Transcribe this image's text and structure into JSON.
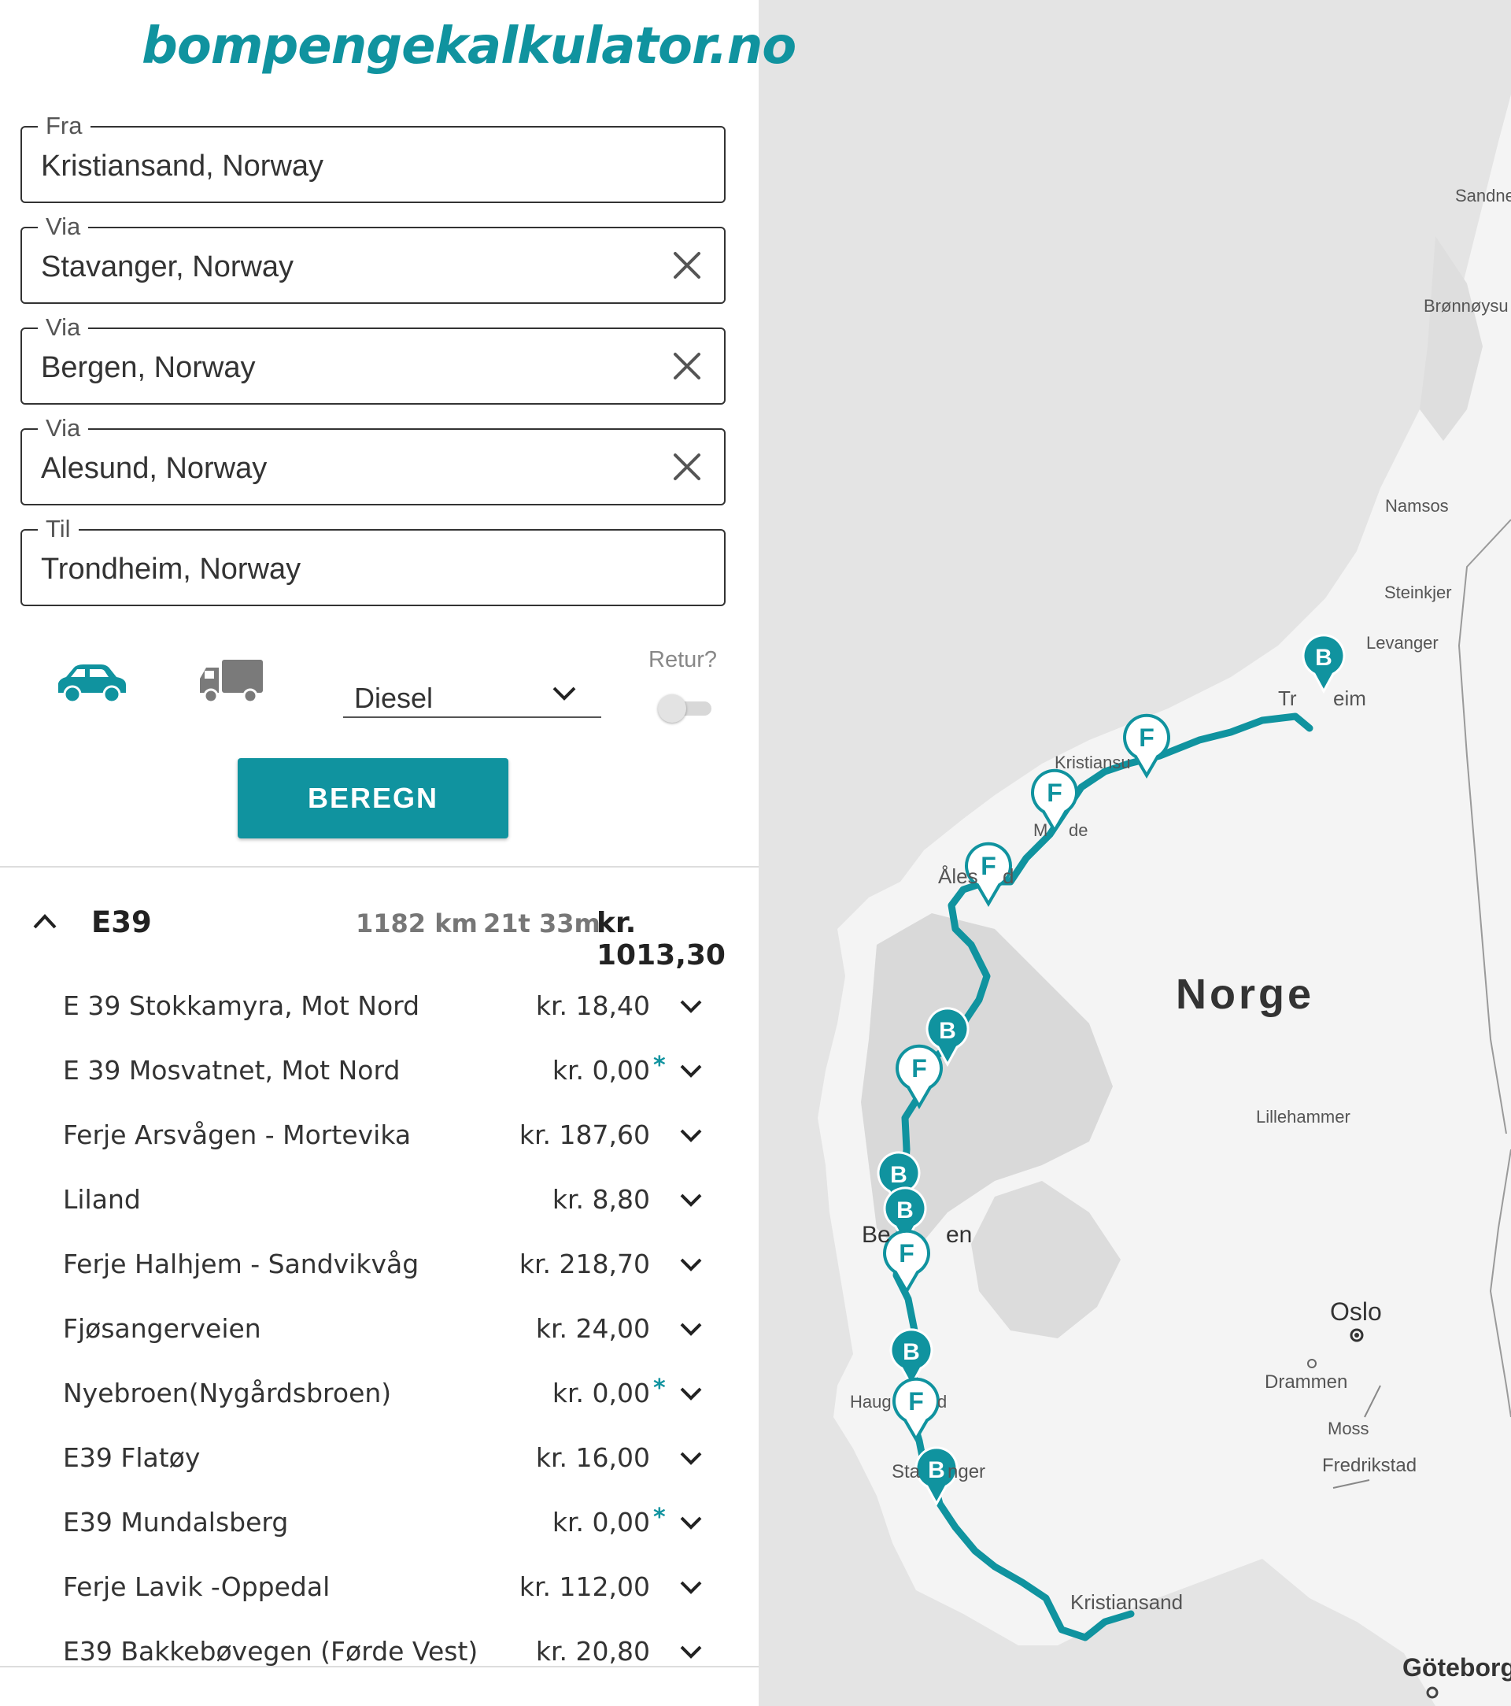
{
  "app": {
    "logo": "bompengekalkulator.no"
  },
  "colors": {
    "accent": "#10939f",
    "map_bg": "#e4e4e4",
    "land": "#f4f4f4"
  },
  "form": {
    "from": {
      "label": "Fra",
      "value": "Kristiansand, Norway"
    },
    "via": [
      {
        "label": "Via",
        "value": "Stavanger, Norway"
      },
      {
        "label": "Via",
        "value": "Bergen, Norway"
      },
      {
        "label": "Via",
        "value": "Alesund, Norway"
      }
    ],
    "to": {
      "label": "Til",
      "value": "Trondheim, Norway"
    },
    "fuel": "Diesel",
    "retur_label": "Retur?",
    "retur_enabled": false,
    "selected_vehicle": "car",
    "submit_label": "BEREGN"
  },
  "route": {
    "name": "E39",
    "distance": "1182 km",
    "duration": "21t 33m",
    "total": "kr. 1013,30",
    "expanded": true,
    "tolls": [
      {
        "name": "E 39 Stokkamyra, Mot Nord",
        "price": "kr. 18,40",
        "star": ""
      },
      {
        "name": "E 39 Mosvatnet, Mot Nord",
        "price": "kr. 0,00",
        "star": "*"
      },
      {
        "name": "Ferje Arsvågen - Mortevika",
        "price": "kr. 187,60",
        "star": ""
      },
      {
        "name": "Liland",
        "price": "kr. 8,80",
        "star": ""
      },
      {
        "name": "Ferje Halhjem - Sandvikvåg",
        "price": "kr. 218,70",
        "star": ""
      },
      {
        "name": "Fjøsangerveien",
        "price": "kr. 24,00",
        "star": ""
      },
      {
        "name": "Nyebroen(Nygårdsbroen)",
        "price": "kr. 0,00",
        "star": "*"
      },
      {
        "name": "E39 Flatøy",
        "price": "kr. 16,00",
        "star": ""
      },
      {
        "name": "E39 Mundalsberg",
        "price": "kr. 0,00",
        "star": "*"
      },
      {
        "name": "Ferje Lavik -Oppedal",
        "price": "kr. 112,00",
        "star": ""
      },
      {
        "name": "E39 Bakkebøvegen (Førde Vest)",
        "price": "kr. 20,80",
        "star": ""
      }
    ]
  },
  "map": {
    "country_label": "Norge",
    "cities": [
      "Sandne",
      "Brønnøysu",
      "Namsos",
      "Steinkjer",
      "Levanger",
      "Tr",
      "eim",
      "Kristiansu",
      "M",
      "de",
      "Åles",
      "d",
      "Lillehammer",
      "Be",
      "en",
      "Oslo",
      "Drammen",
      "Moss",
      "Fredrikstad",
      "Haug",
      "d",
      "Sta",
      "nger",
      "Kristiansand",
      "Göteborg"
    ],
    "marker_letters": {
      "toll": "B",
      "ferry": "F"
    }
  }
}
